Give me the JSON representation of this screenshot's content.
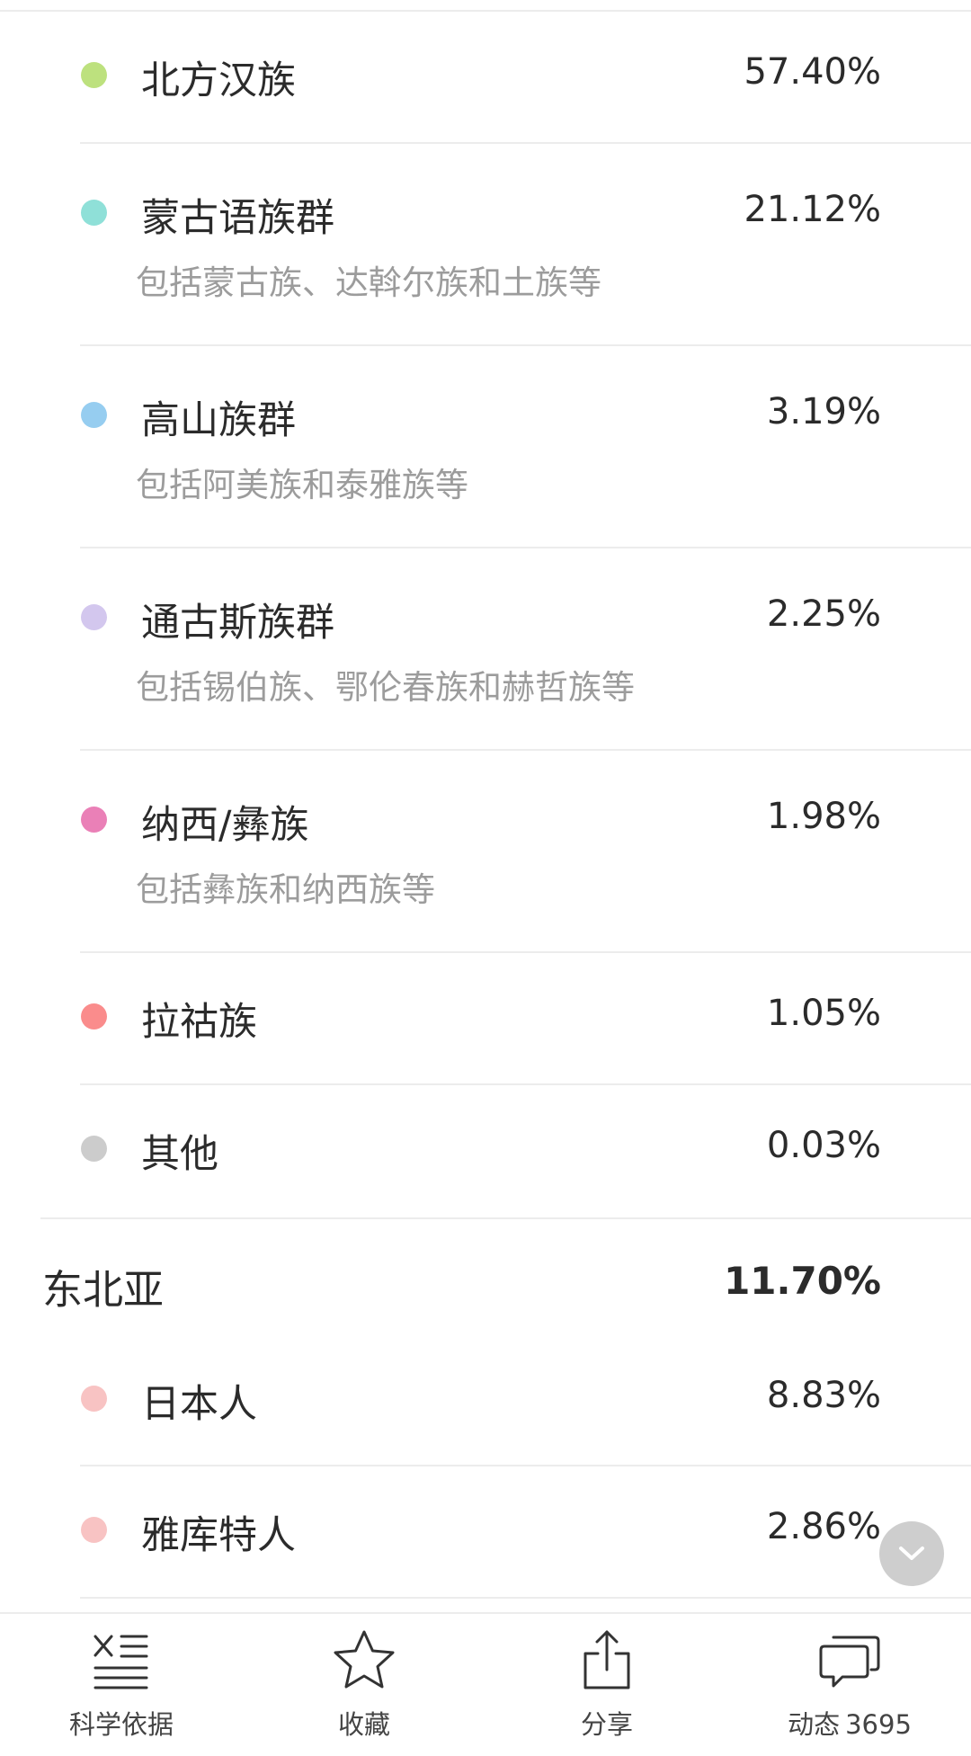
{
  "groups_top": [
    {
      "label": "北方汉族",
      "percent": "57.40%",
      "sub": "",
      "color": "#bde17e"
    },
    {
      "label": "蒙古语族群",
      "percent": "21.12%",
      "sub": "包括蒙古族、达斡尔族和土族等",
      "color": "#8fe0d8"
    },
    {
      "label": "高山族群",
      "percent": "3.19%",
      "sub": "包括阿美族和泰雅族等",
      "color": "#96cdf0"
    },
    {
      "label": "通古斯族群",
      "percent": "2.25%",
      "sub": "包括锡伯族、鄂伦春族和赫哲族等",
      "color": "#d3c7ee"
    },
    {
      "label": "纳西/彝族",
      "percent": "1.98%",
      "sub": "包括彝族和纳西族等",
      "color": "#ea80b7"
    },
    {
      "label": "拉祜族",
      "percent": "1.05%",
      "sub": "",
      "color": "#fa8c8c"
    },
    {
      "label": "其他",
      "percent": "0.03%",
      "sub": "",
      "color": "#cccccc"
    }
  ],
  "region": {
    "title": "东北亚",
    "percent": "11.70%"
  },
  "groups_region": [
    {
      "label": "日本人",
      "percent": "8.83%",
      "sub": "",
      "color": "#f8c3c3"
    },
    {
      "label": "雅库特人",
      "percent": "2.86%",
      "sub": "",
      "color": "#f8c3c3"
    }
  ],
  "icons": {
    "scroll_down": "chevron-down-icon",
    "science": "science-basis-icon",
    "favorite": "star-icon",
    "share": "share-icon",
    "activity": "chat-bubbles-icon"
  },
  "bottom_bar": {
    "science_label": "科学依据",
    "favorite_label": "收藏",
    "share_label": "分享",
    "activity_label": "动态",
    "activity_count": "3695"
  }
}
